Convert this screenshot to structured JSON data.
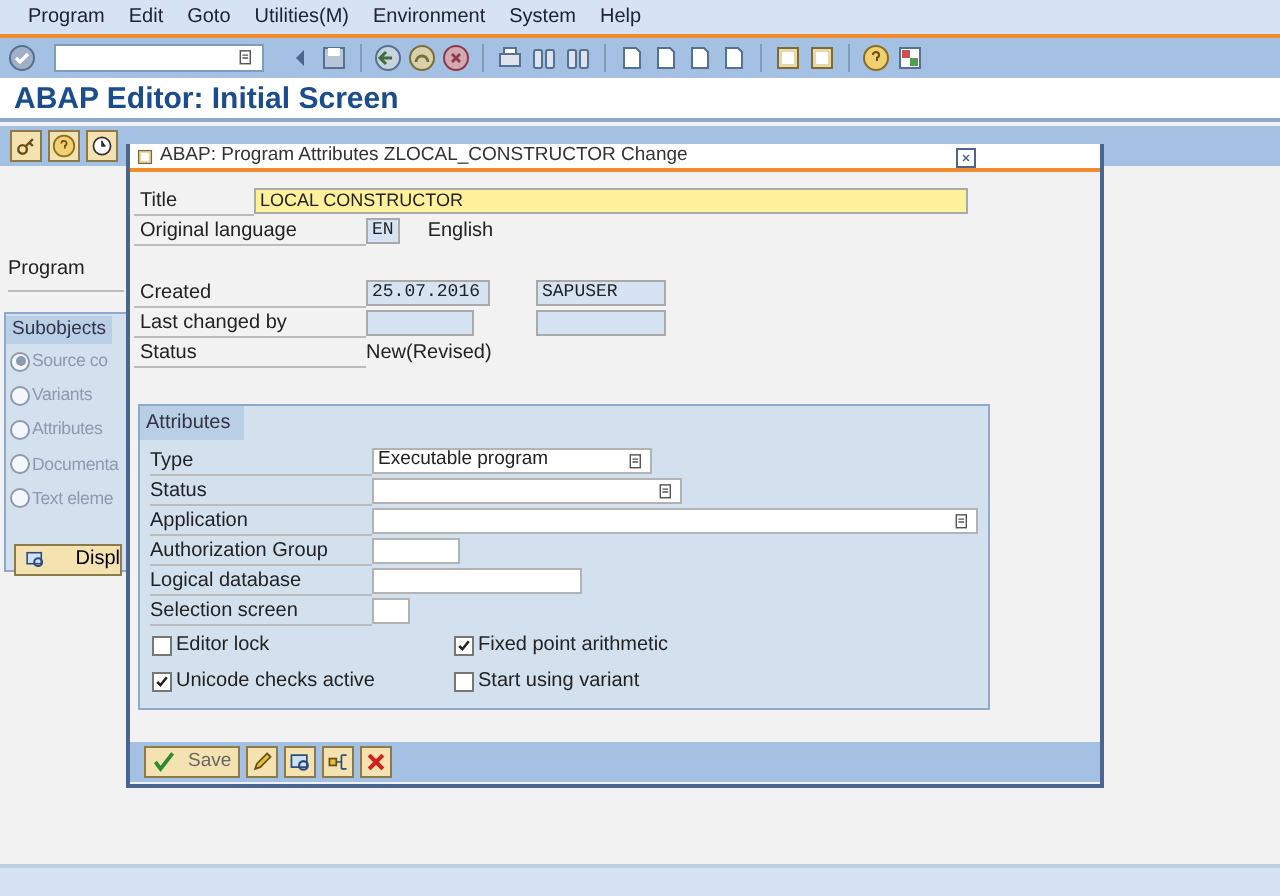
{
  "menu": [
    "Program",
    "Edit",
    "Goto",
    "Utilities(M)",
    "Environment",
    "System",
    "Help"
  ],
  "title": "ABAP Editor: Initial Screen",
  "program_label": "Program",
  "subobjects": {
    "title": "Subobjects",
    "options": [
      {
        "label": "Source co",
        "selected": true
      },
      {
        "label": "Variants",
        "selected": false
      },
      {
        "label": "Attributes",
        "selected": false
      },
      {
        "label": "Documenta",
        "selected": false
      },
      {
        "label": "Text eleme",
        "selected": false
      }
    ],
    "button": "Displ"
  },
  "dialog": {
    "title": "ABAP: Program Attributes ZLOCAL_CONSTRUCTOR Change",
    "title_field": {
      "label": "Title",
      "value": "LOCAL CONSTRUCTOR"
    },
    "original_language": {
      "label": "Original language",
      "code": "EN",
      "name": "English"
    },
    "created": {
      "label": "Created",
      "date": "25.07.2016",
      "user": "SAPUSER"
    },
    "last_changed": {
      "label": "Last changed by"
    },
    "status": {
      "label": "Status",
      "value": "New(Revised)"
    },
    "attributes": {
      "title": "Attributes",
      "rows": [
        {
          "label": "Type",
          "kind": "dropdown",
          "value": "Executable program"
        },
        {
          "label": "Status",
          "kind": "dropdown"
        },
        {
          "label": "Application",
          "kind": "dropdown"
        },
        {
          "label": "Authorization Group",
          "kind": "text"
        },
        {
          "label": "Logical database",
          "kind": "text"
        },
        {
          "label": "Selection screen",
          "kind": "text"
        }
      ],
      "checkboxes": [
        {
          "label": "Editor lock",
          "checked": false
        },
        {
          "label": "Fixed point arithmetic",
          "checked": true
        },
        {
          "label": "Unicode checks active",
          "checked": true
        },
        {
          "label": "Start using variant",
          "checked": false
        }
      ]
    },
    "save_button": "Save"
  }
}
